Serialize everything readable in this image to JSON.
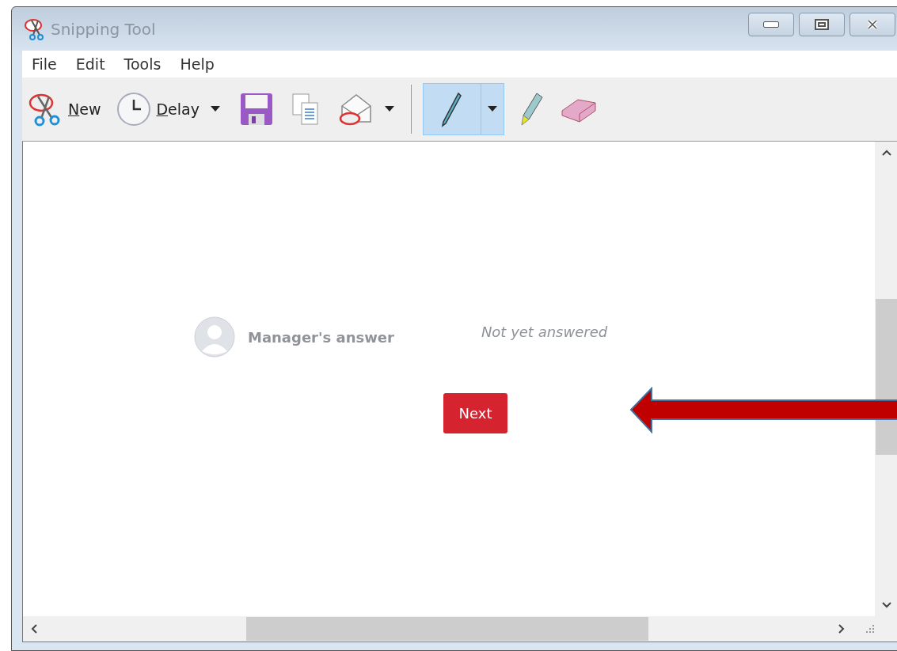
{
  "window": {
    "title": "Snipping Tool"
  },
  "menu": [
    "File",
    "Edit",
    "Tools",
    "Help"
  ],
  "toolbar": [
    {
      "kind": "new",
      "label": "New",
      "accelerator": true,
      "selected": false
    },
    {
      "kind": "delay",
      "label": "Delay",
      "accelerator": true,
      "selected": false
    },
    {
      "kind": "save",
      "selected": false
    },
    {
      "kind": "copy",
      "selected": false
    },
    {
      "kind": "send",
      "selected": false
    },
    {
      "kind": "pen",
      "selected": true
    },
    {
      "kind": "highlighter",
      "selected": false
    },
    {
      "kind": "eraser",
      "selected": false
    }
  ],
  "content": {
    "label": "Manager's answer",
    "status": "Not yet answered",
    "button": "Next"
  }
}
